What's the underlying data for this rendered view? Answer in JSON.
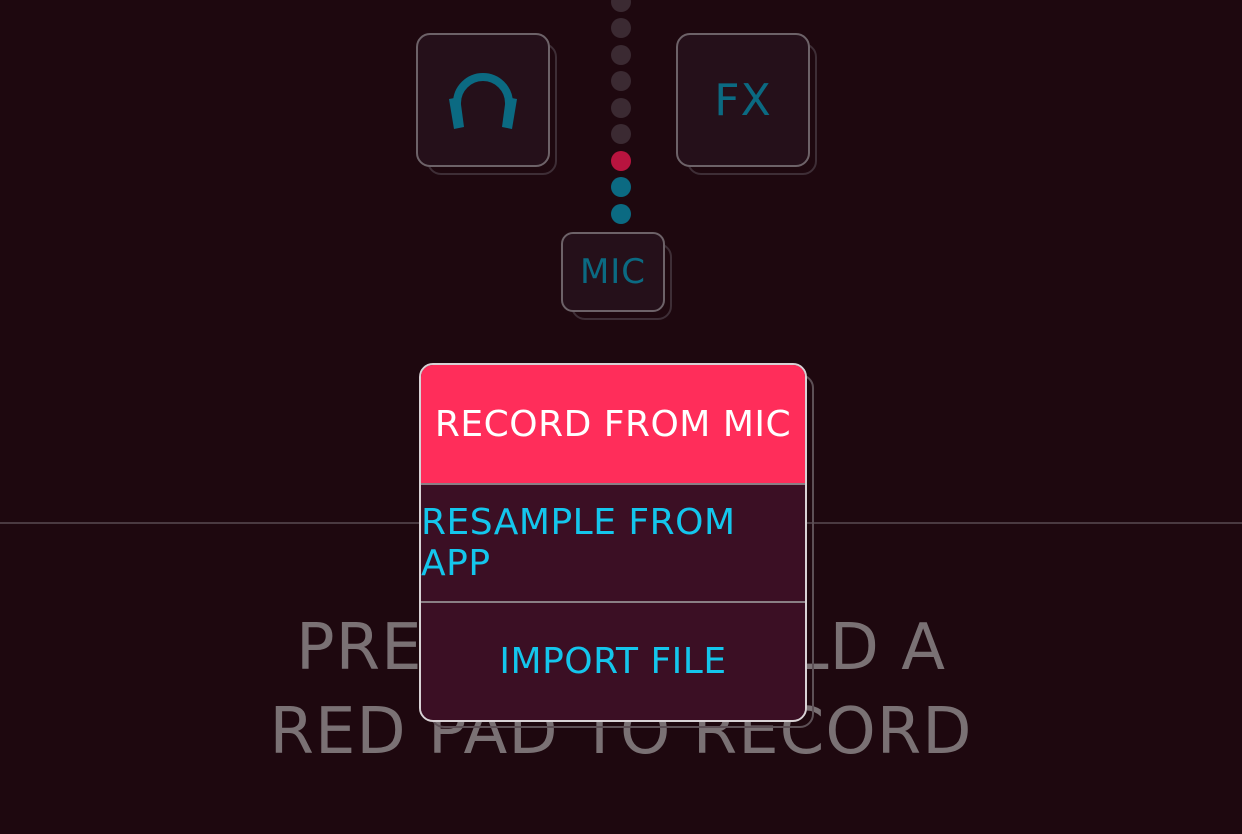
{
  "colors": {
    "background": "#1e080f",
    "accent": "#ff2d5a",
    "teal": "#0b6a82",
    "menu_text": "#14c6ec",
    "menu_bg": "#3b0f24"
  },
  "controls": {
    "headphones_icon": "headphones-icon",
    "fx_label": "FX",
    "mic_label": "MIC"
  },
  "level_meter": {
    "dots": [
      "off",
      "off",
      "off",
      "off",
      "off",
      "red",
      "teal",
      "teal"
    ],
    "colors": {
      "off": "#3b2a32",
      "red": "#b8143f",
      "teal": "#0b6a82"
    }
  },
  "prompt": {
    "line1": "PRESS AND HOLD A",
    "line2": "RED PAD TO RECORD"
  },
  "menu": {
    "items": [
      {
        "label": "RECORD FROM MIC",
        "active": true
      },
      {
        "label": "RESAMPLE FROM APP",
        "active": false
      },
      {
        "label": "IMPORT FILE",
        "active": false
      }
    ]
  }
}
